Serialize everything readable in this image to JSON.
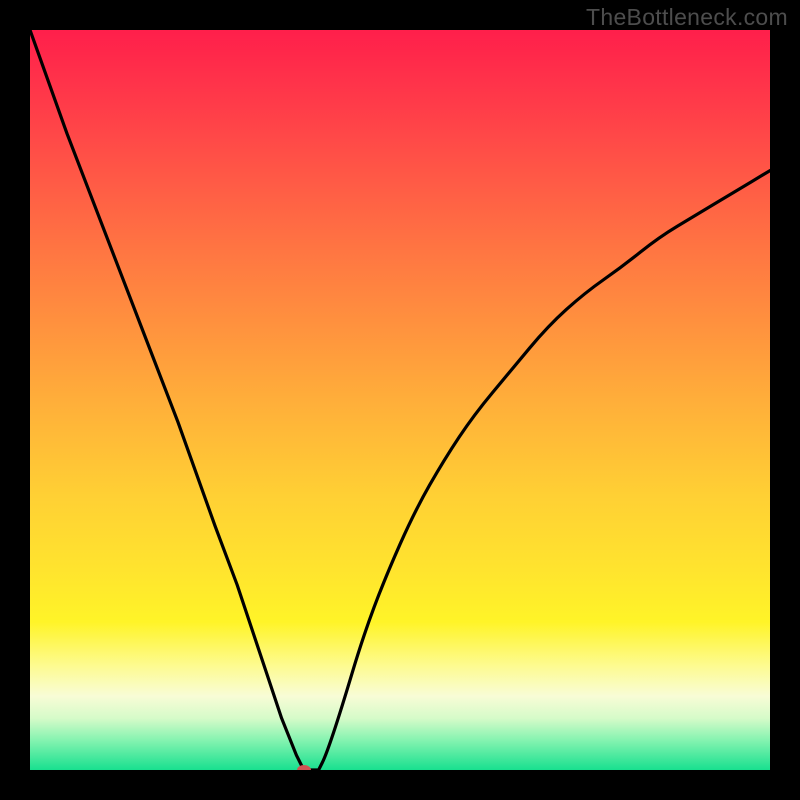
{
  "watermark": "TheBottleneck.com",
  "chart_data": {
    "type": "line",
    "title": "",
    "xlabel": "",
    "ylabel": "",
    "xlim": [
      0,
      100
    ],
    "ylim": [
      0,
      100
    ],
    "grid": false,
    "series": [
      {
        "name": "bottleneck-curve",
        "x": [
          0,
          5,
          10,
          15,
          20,
          25,
          28,
          30,
          32,
          34,
          35,
          36,
          37,
          38,
          39,
          40,
          42,
          45,
          48,
          52,
          56,
          60,
          65,
          70,
          75,
          80,
          85,
          90,
          95,
          100
        ],
        "values": [
          100,
          86,
          73,
          60,
          47,
          33,
          25,
          19,
          13,
          7,
          4.5,
          2,
          0,
          0,
          0,
          2,
          8,
          18,
          26,
          35,
          42,
          48,
          54,
          60,
          64.5,
          68,
          72,
          75,
          78,
          81
        ]
      }
    ],
    "marker": {
      "x": 37,
      "y": 0,
      "color": "#cf5353"
    },
    "background_gradient": {
      "top": "#ff1f4b",
      "middle": "#ffe42e",
      "bottom": "#18e08f"
    }
  }
}
